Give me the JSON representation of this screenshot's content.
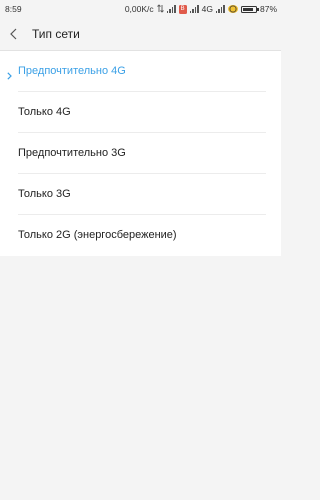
{
  "status_bar": {
    "time": "8:59",
    "network_speed": "0,00K/c",
    "network_type": "4G",
    "sim_badge": "B",
    "battery_percent": "87%",
    "battery_level": 0.87
  },
  "header": {
    "title": "Тип сети"
  },
  "network_options": [
    {
      "label": "Предпочтительно 4G",
      "selected": true
    },
    {
      "label": "Только 4G",
      "selected": false
    },
    {
      "label": "Предпочтительно 3G",
      "selected": false
    },
    {
      "label": "Только 3G",
      "selected": false
    },
    {
      "label": "Только 2G (энергосбережение)",
      "selected": false
    }
  ],
  "colors": {
    "accent": "#3ba0e6",
    "background": "#f4f4f4",
    "list_background": "#ffffff",
    "text": "#1f1f1f"
  }
}
